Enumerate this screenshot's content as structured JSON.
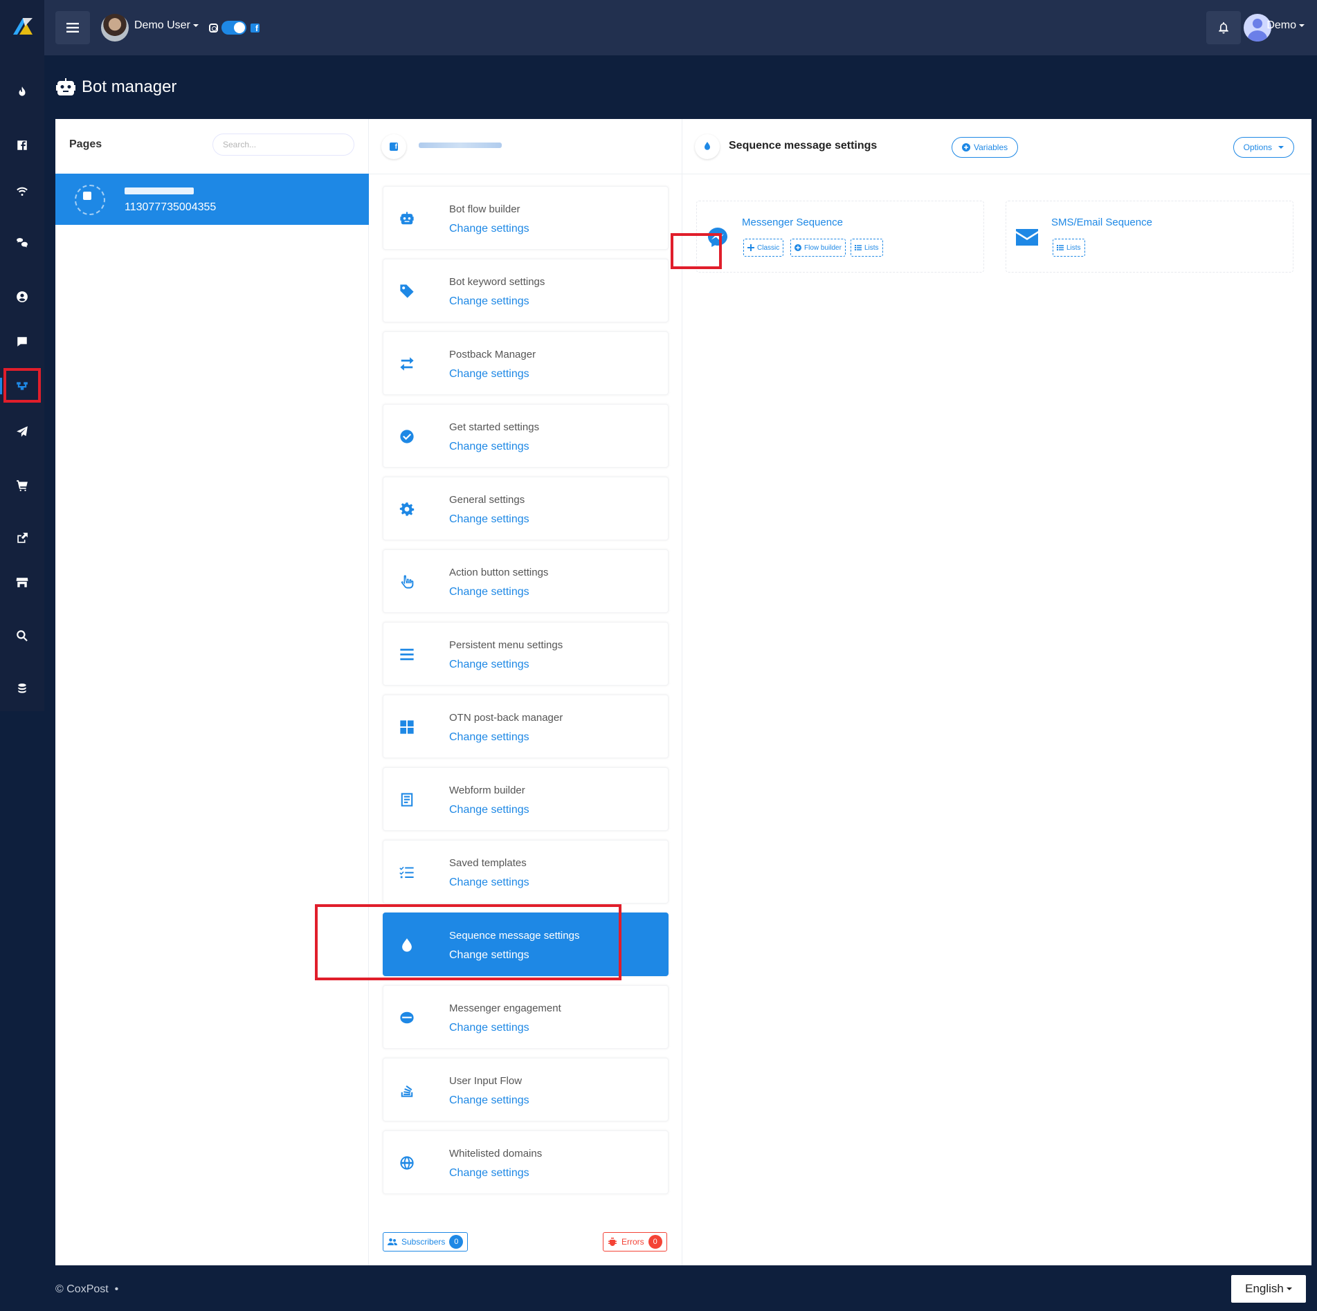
{
  "topbar": {
    "user_name": "Demo User",
    "account_name": "Demo"
  },
  "page_title": "Bot manager",
  "pages_panel": {
    "title": "Pages",
    "search_placeholder": "Search...",
    "items": [
      {
        "page_id": "113077735004355"
      }
    ]
  },
  "settings_panel": {
    "items": [
      {
        "name": "Bot flow builder",
        "icon": "robot-icon",
        "link": "Change settings"
      },
      {
        "name": "Bot keyword settings",
        "icon": "tag-icon",
        "link": "Change settings"
      },
      {
        "name": "Postback Manager",
        "icon": "exchange-icon",
        "link": "Change settings"
      },
      {
        "name": "Get started settings",
        "icon": "check-circle-icon",
        "link": "Change settings"
      },
      {
        "name": "General settings",
        "icon": "gear-icon",
        "link": "Change settings"
      },
      {
        "name": "Action button settings",
        "icon": "hand-pointer-icon",
        "link": "Change settings"
      },
      {
        "name": "Persistent menu settings",
        "icon": "menu-lines-icon",
        "link": "Change settings"
      },
      {
        "name": "OTN post-back manager",
        "icon": "grid-icon",
        "link": "Change settings"
      },
      {
        "name": "Webform builder",
        "icon": "form-icon",
        "link": "Change settings"
      },
      {
        "name": "Saved templates",
        "icon": "list-check-icon",
        "link": "Change settings"
      },
      {
        "name": "Sequence message settings",
        "icon": "drop-icon",
        "link": "Change settings",
        "active": true
      },
      {
        "name": "Messenger engagement",
        "icon": "engagement-icon",
        "link": "Change settings"
      },
      {
        "name": "User Input Flow",
        "icon": "stack-icon",
        "link": "Change settings"
      },
      {
        "name": "Whitelisted domains",
        "icon": "globe-icon",
        "link": "Change settings"
      }
    ],
    "subscribers_label": "Subscribers",
    "subscribers_count": "0",
    "errors_label": "Errors",
    "errors_count": "0"
  },
  "sequence_panel": {
    "title": "Sequence message settings",
    "variables_label": "Variables",
    "options_label": "Options",
    "messenger": {
      "title": "Messenger Sequence",
      "classic_label": "Classic",
      "flow_builder_label": "Flow builder",
      "lists_label": "Lists"
    },
    "sms_email": {
      "title": "SMS/Email Sequence",
      "lists_label": "Lists"
    }
  },
  "footer": {
    "copyright": "© CoxPost",
    "language": "English"
  },
  "colors": {
    "accent": "#1e88e5",
    "sidebar": "#14213d",
    "topbar": "#22304f",
    "page_bg": "#0e1f3d",
    "highlight": "#e01e2b",
    "error": "#f44336"
  }
}
